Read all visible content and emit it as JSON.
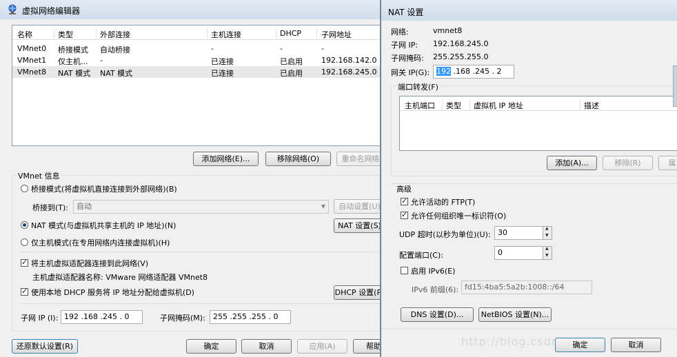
{
  "left": {
    "title": "虚拟网络编辑器",
    "table": {
      "columns": [
        "名称",
        "类型",
        "外部连接",
        "主机连接",
        "DHCP",
        "子网地址"
      ],
      "rows": [
        [
          "VMnet0",
          "桥接模式",
          "自动桥接",
          "-",
          "-",
          "-"
        ],
        [
          "VMnet1",
          "仅主机...",
          "-",
          "已连接",
          "已启用",
          "192.168.142.0"
        ],
        [
          "VMnet8",
          "NAT 模式",
          "NAT 模式",
          "已连接",
          "已启用",
          "192.168.245.0"
        ]
      ]
    },
    "add_network": "添加网络(E)...",
    "remove_network": "移除网络(O)",
    "rename_network": "重命名网络",
    "vmnet_info": "VMnet 信息",
    "bridge_mode": "桥接模式(将虚拟机直接连接到外部网络)(B)",
    "bridge_to_label": "桥接到(T):",
    "bridge_to_value": "自动",
    "auto_settings": "自动设置(U)",
    "nat_mode": "NAT 模式(与虚拟机共享主机的 IP 地址)(N)",
    "nat_settings": "NAT 设置(S)",
    "host_only_mode": "仅主机模式(在专用网络内连接虚拟机)(H)",
    "connect_adapter": "将主机虚拟适配器连接到此网络(V)",
    "adapter_name": "主机虚拟适配器名称: VMware 网络适配器 VMnet8",
    "use_dhcp": "使用本地 DHCP 服务将 IP 地址分配给虚拟机(D)",
    "dhcp_settings": "DHCP 设置(P)",
    "subnet_ip_label": "子网 IP (I):",
    "subnet_ip": "192 .168 .245 . 0",
    "subnet_mask_label": "子网掩码(M):",
    "subnet_mask": "255 .255 .255 . 0",
    "restore_defaults": "还原默认设置(R)",
    "ok": "确定",
    "cancel": "取消",
    "apply": "应用(A)",
    "help": "帮助"
  },
  "right": {
    "title": "NAT 设置",
    "network_label": "网络:",
    "network_value": "vmnet8",
    "subnet_ip_label": "子网 IP:",
    "subnet_ip_value": "192.168.245.0",
    "subnet_mask_label": "子网掩码:",
    "subnet_mask_value": "255.255.255.0",
    "gateway_label": "网关 IP(G):",
    "gateway_sel": "192",
    "gateway_rest": " .168 .245 . 2",
    "port_forwarding": "端口转发(F)",
    "pf_columns": [
      "主机端口",
      "类型",
      "虚拟机 IP 地址",
      "描述"
    ],
    "add": "添加(A)...",
    "remove": "移除(R)",
    "properties": "属",
    "advanced": "高级",
    "allow_ftp": "允许活动的 FTP(T)",
    "allow_oui": "允许任何组织唯一标识符(O)",
    "udp_timeout_label": "UDP 超时(以秒为单位)(U):",
    "udp_timeout": "30",
    "config_port_label": "配置端口(C):",
    "config_port": "0",
    "enable_ipv6": "启用 IPv6(E)",
    "ipv6_prefix_label": "IPv6 前缀(6):",
    "ipv6_prefix": "fd15:4ba5:5a2b:1008::/64",
    "dns_settings": "DNS 设置(D)...",
    "netbios_settings": "NetBIOS 设置(N)...",
    "ok": "确定",
    "cancel": "取消",
    "watermark": "http://blog.csdn.net/..."
  },
  "colors": {
    "titlebar": "#dbe6f2",
    "selection": "#3399ff",
    "window_bg": "#f0f0f0"
  }
}
